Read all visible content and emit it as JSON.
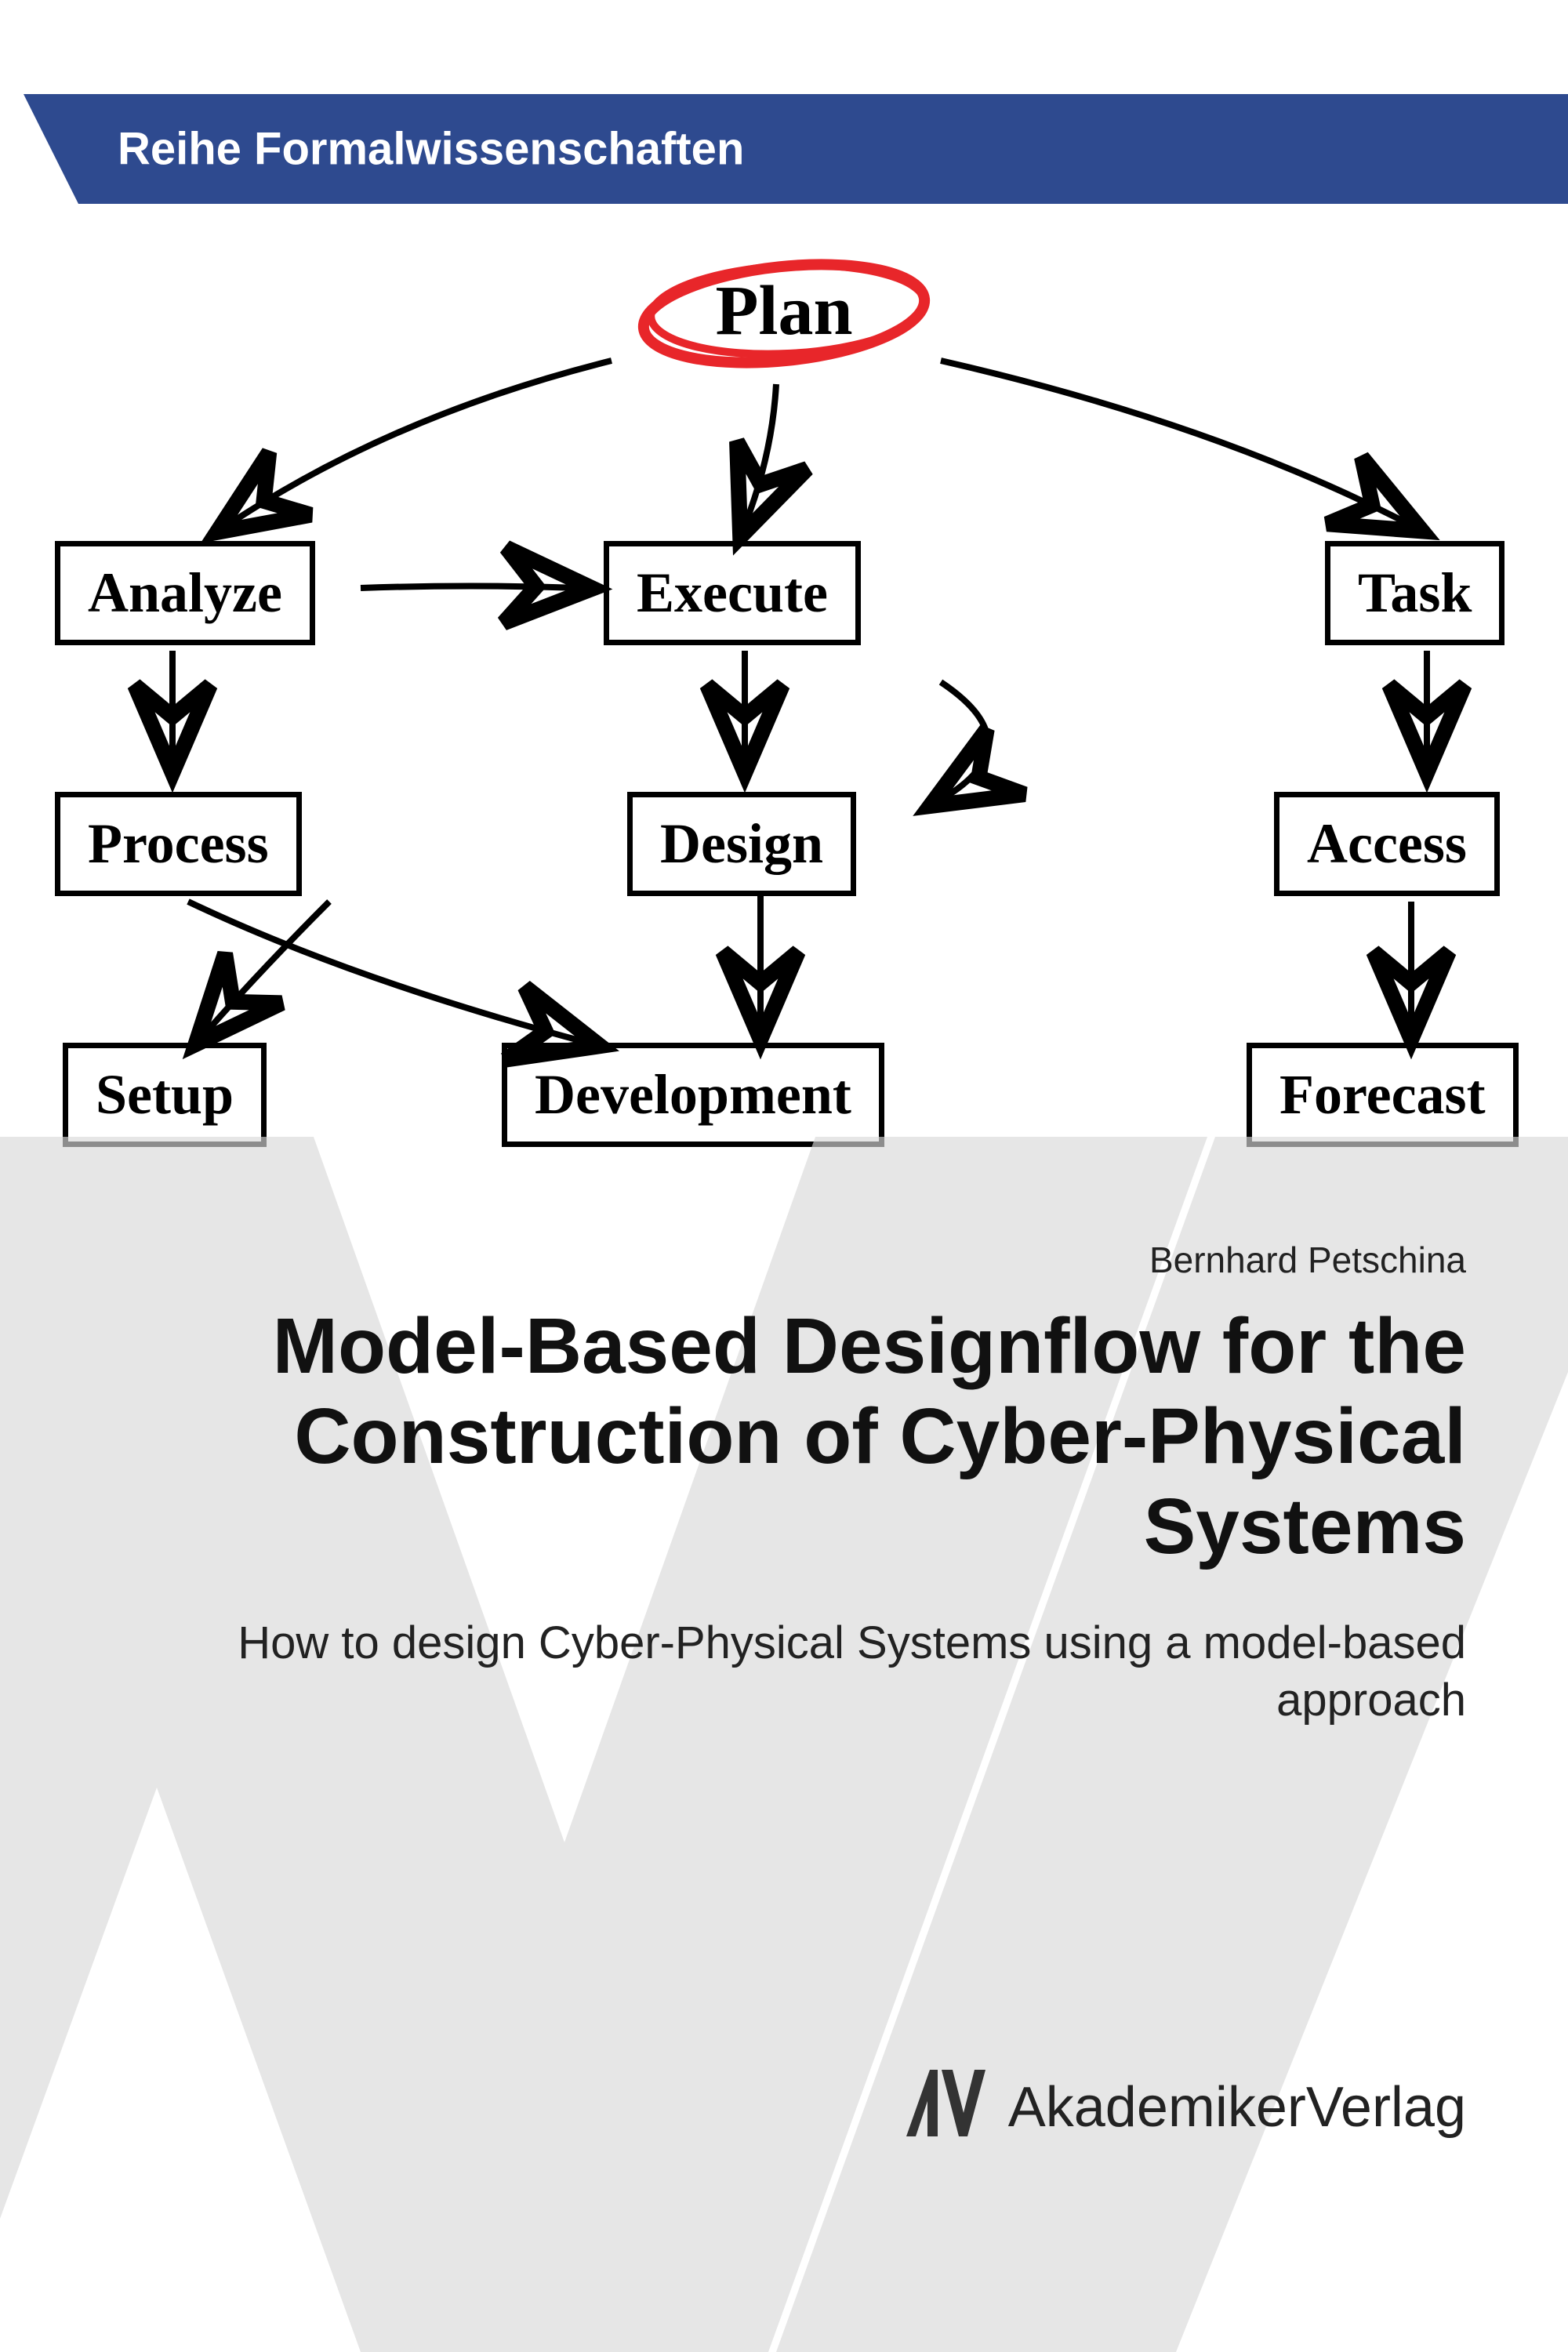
{
  "series_label": "Reihe Formalwissenschaften",
  "diagram": {
    "plan": "Plan",
    "analyze": "Analyze",
    "execute": "Execute",
    "task": "Task",
    "process": "Process",
    "design": "Design",
    "access": "Access",
    "setup": "Setup",
    "development": "Development",
    "forecast": "Forecast"
  },
  "author": "Bernhard Petschina",
  "title": "Model-Based Designflow for the Construction of Cyber-Physical Systems",
  "subtitle": "How to design Cyber-Physical Systems using a model-based approach",
  "publisher": "AkademikerVerlag"
}
